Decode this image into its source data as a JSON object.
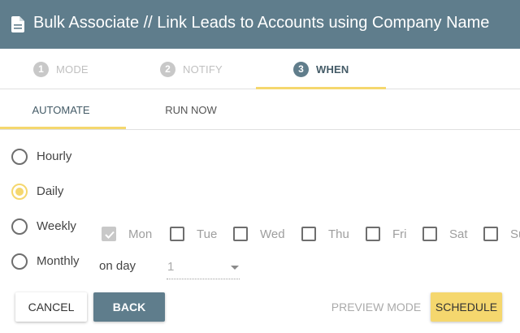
{
  "header": {
    "title": "Bulk Associate // Link Leads to Accounts using Company Name",
    "icon": "document-icon",
    "background": "#5f7d8c"
  },
  "steps": [
    {
      "number": "1",
      "label": "MODE",
      "active": false
    },
    {
      "number": "2",
      "label": "NOTIFY",
      "active": false
    },
    {
      "number": "3",
      "label": "WHEN",
      "active": true
    }
  ],
  "tabs": [
    {
      "label": "AUTOMATE",
      "active": true
    },
    {
      "label": "RUN NOW",
      "active": false
    }
  ],
  "frequency": {
    "options": [
      "Hourly",
      "Daily",
      "Weekly",
      "Monthly"
    ],
    "selected": "Daily"
  },
  "weekdays": [
    {
      "label": "Mon",
      "checked": true
    },
    {
      "label": "Tue",
      "checked": false
    },
    {
      "label": "Wed",
      "checked": false
    },
    {
      "label": "Thu",
      "checked": false
    },
    {
      "label": "Fri",
      "checked": false
    },
    {
      "label": "Sat",
      "checked": false
    },
    {
      "label": "Su",
      "checked": false
    }
  ],
  "monthly": {
    "label": "on day",
    "value": "1"
  },
  "buttons": {
    "cancel": "CANCEL",
    "back": "BACK",
    "preview": "PREVIEW MODE",
    "schedule": "SCHEDULE"
  },
  "colors": {
    "accent": "#f5d76e",
    "primary": "#5f7d8c"
  }
}
